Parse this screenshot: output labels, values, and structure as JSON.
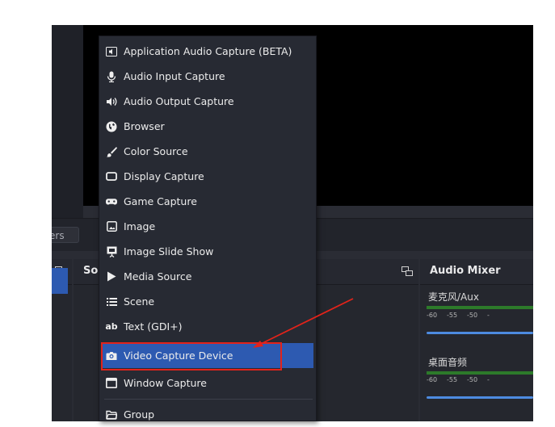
{
  "toolbar": {
    "filters_label": "ers"
  },
  "sources_dock": {
    "title": "So"
  },
  "audio_mixer": {
    "title": "Audio Mixer",
    "channels": [
      {
        "name": "麦克风/Aux",
        "ticks": [
          "-60",
          "-55",
          "-50",
          "-"
        ]
      },
      {
        "name": "桌面音频",
        "ticks": [
          "-60",
          "-55",
          "-50",
          "-"
        ]
      }
    ]
  },
  "menu": {
    "items": [
      {
        "label": "Application Audio Capture (BETA)",
        "icon": "app-audio-icon"
      },
      {
        "label": "Audio Input Capture",
        "icon": "microphone-icon"
      },
      {
        "label": "Audio Output Capture",
        "icon": "speaker-icon"
      },
      {
        "label": "Browser",
        "icon": "globe-icon"
      },
      {
        "label": "Color Source",
        "icon": "paintbrush-icon"
      },
      {
        "label": "Display Capture",
        "icon": "monitor-icon"
      },
      {
        "label": "Game Capture",
        "icon": "gamepad-icon"
      },
      {
        "label": "Image",
        "icon": "image-icon"
      },
      {
        "label": "Image Slide Show",
        "icon": "slideshow-icon"
      },
      {
        "label": "Media Source",
        "icon": "play-icon"
      },
      {
        "label": "Scene",
        "icon": "list-icon"
      },
      {
        "label": "Text (GDI+)",
        "icon": "text-icon"
      },
      {
        "label": "Video Capture Device",
        "icon": "camera-icon",
        "selected": true
      },
      {
        "label": "Window Capture",
        "icon": "window-icon"
      },
      {
        "label": "Group",
        "icon": "folder-icon"
      }
    ]
  },
  "annotation": {
    "highlight_color": "#e2231a",
    "selection_color": "#2d5ab1"
  }
}
